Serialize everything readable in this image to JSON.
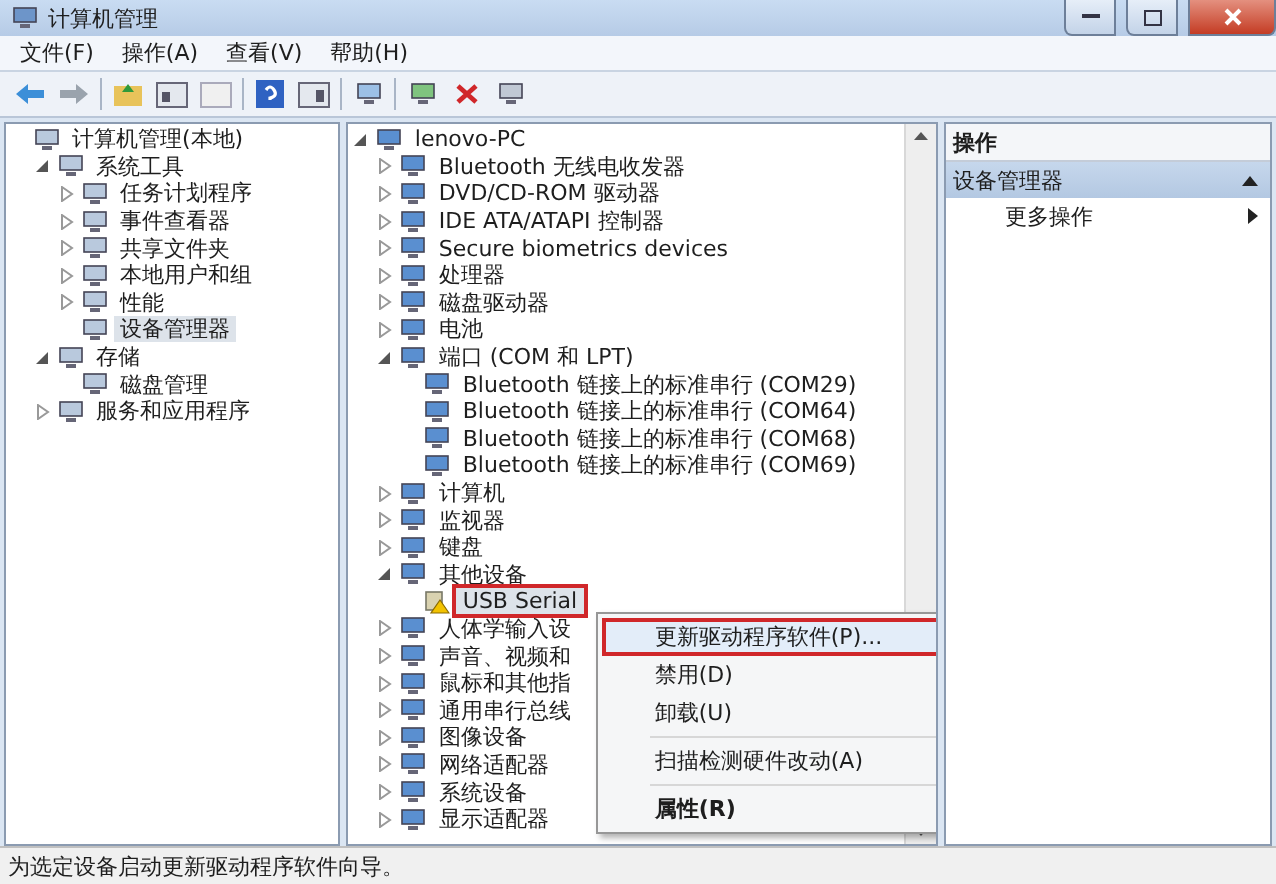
{
  "window": {
    "title": "计算机管理"
  },
  "menu_bar": [
    "文件(F)",
    "操作(A)",
    "查看(V)",
    "帮助(H)"
  ],
  "left_tree": [
    {
      "label": "计算机管理(本地)",
      "kind": "leaf",
      "selected": false,
      "children": [
        {
          "label": "系统工具",
          "kind": "node",
          "expanded": true,
          "selected": false,
          "children": [
            {
              "label": "任务计划程序",
              "kind": "node",
              "expanded": false,
              "selected": false
            },
            {
              "label": "事件查看器",
              "kind": "node",
              "expanded": false,
              "selected": false
            },
            {
              "label": "共享文件夹",
              "kind": "node",
              "expanded": false,
              "selected": false
            },
            {
              "label": "本地用户和组",
              "kind": "node",
              "expanded": false,
              "selected": false
            },
            {
              "label": "性能",
              "kind": "node",
              "expanded": false,
              "selected": false
            },
            {
              "label": "设备管理器",
              "kind": "leaf",
              "selected": true
            }
          ]
        },
        {
          "label": "存储",
          "kind": "node",
          "expanded": true,
          "selected": false,
          "children": [
            {
              "label": "磁盘管理",
              "kind": "leaf",
              "selected": false
            }
          ]
        },
        {
          "label": "服务和应用程序",
          "kind": "node",
          "expanded": false,
          "selected": false
        }
      ]
    }
  ],
  "device_tree": [
    {
      "label": "lenovo-PC",
      "kind": "node",
      "expanded": true,
      "selected": false,
      "children": [
        {
          "label": "Bluetooth 无线电收发器",
          "kind": "node",
          "expanded": false,
          "selected": false
        },
        {
          "label": "DVD/CD-ROM 驱动器",
          "kind": "node",
          "expanded": false,
          "selected": false
        },
        {
          "label": "IDE ATA/ATAPI 控制器",
          "kind": "node",
          "expanded": false,
          "selected": false
        },
        {
          "label": "Secure biometrics devices",
          "kind": "node",
          "expanded": false,
          "selected": false
        },
        {
          "label": "处理器",
          "kind": "node",
          "expanded": false,
          "selected": false
        },
        {
          "label": "磁盘驱动器",
          "kind": "node",
          "expanded": false,
          "selected": false
        },
        {
          "label": "电池",
          "kind": "node",
          "expanded": false,
          "selected": false
        },
        {
          "label": "端口 (COM 和 LPT)",
          "kind": "node",
          "expanded": true,
          "selected": false,
          "children": [
            {
              "label": "Bluetooth 链接上的标准串行 (COM29)",
              "kind": "leaf",
              "selected": false
            },
            {
              "label": "Bluetooth 链接上的标准串行 (COM64)",
              "kind": "leaf",
              "selected": false
            },
            {
              "label": "Bluetooth 链接上的标准串行 (COM68)",
              "kind": "leaf",
              "selected": false
            },
            {
              "label": "Bluetooth 链接上的标准串行 (COM69)",
              "kind": "leaf",
              "selected": false
            }
          ]
        },
        {
          "label": "计算机",
          "kind": "node",
          "expanded": false,
          "selected": false
        },
        {
          "label": "监视器",
          "kind": "node",
          "expanded": false,
          "selected": false
        },
        {
          "label": "键盘",
          "kind": "node",
          "expanded": false,
          "selected": false
        },
        {
          "label": "其他设备",
          "kind": "node",
          "expanded": true,
          "selected": false,
          "children": [
            {
              "label": "USB Serial",
              "kind": "leaf",
              "selected": true,
              "outlined": true,
              "warning": true
            }
          ]
        },
        {
          "label": "人体学输入设",
          "kind": "node",
          "expanded": false,
          "selected": false
        },
        {
          "label": "声音、视频和",
          "kind": "node",
          "expanded": false,
          "selected": false
        },
        {
          "label": "鼠标和其他指",
          "kind": "node",
          "expanded": false,
          "selected": false
        },
        {
          "label": "通用串行总线",
          "kind": "node",
          "expanded": false,
          "selected": false
        },
        {
          "label": "图像设备",
          "kind": "node",
          "expanded": false,
          "selected": false
        },
        {
          "label": "网络适配器",
          "kind": "node",
          "expanded": false,
          "selected": false
        },
        {
          "label": "系统设备",
          "kind": "node",
          "expanded": false,
          "selected": false
        },
        {
          "label": "显示适配器",
          "kind": "node",
          "expanded": false,
          "selected": false
        }
      ]
    }
  ],
  "context_menu": [
    {
      "label": "更新驱动程序软件(P)...",
      "selected": true,
      "outlined": true,
      "bold": false,
      "separator_before": false
    },
    {
      "label": "禁用(D)",
      "selected": false,
      "outlined": false,
      "bold": false,
      "separator_before": false
    },
    {
      "label": "卸载(U)",
      "selected": false,
      "outlined": false,
      "bold": false,
      "separator_before": false
    },
    {
      "label": "扫描检测硬件改动(A)",
      "selected": false,
      "outlined": false,
      "bold": false,
      "separator_before": true
    },
    {
      "label": "属性(R)",
      "selected": false,
      "outlined": false,
      "bold": true,
      "separator_before": true
    }
  ],
  "actions_pane": {
    "header": "操作",
    "section": {
      "title": "设备管理器",
      "expanded": true
    },
    "items": [
      "更多操作"
    ]
  },
  "status_bar": "为选定设备启动更新驱动程序软件向导。"
}
